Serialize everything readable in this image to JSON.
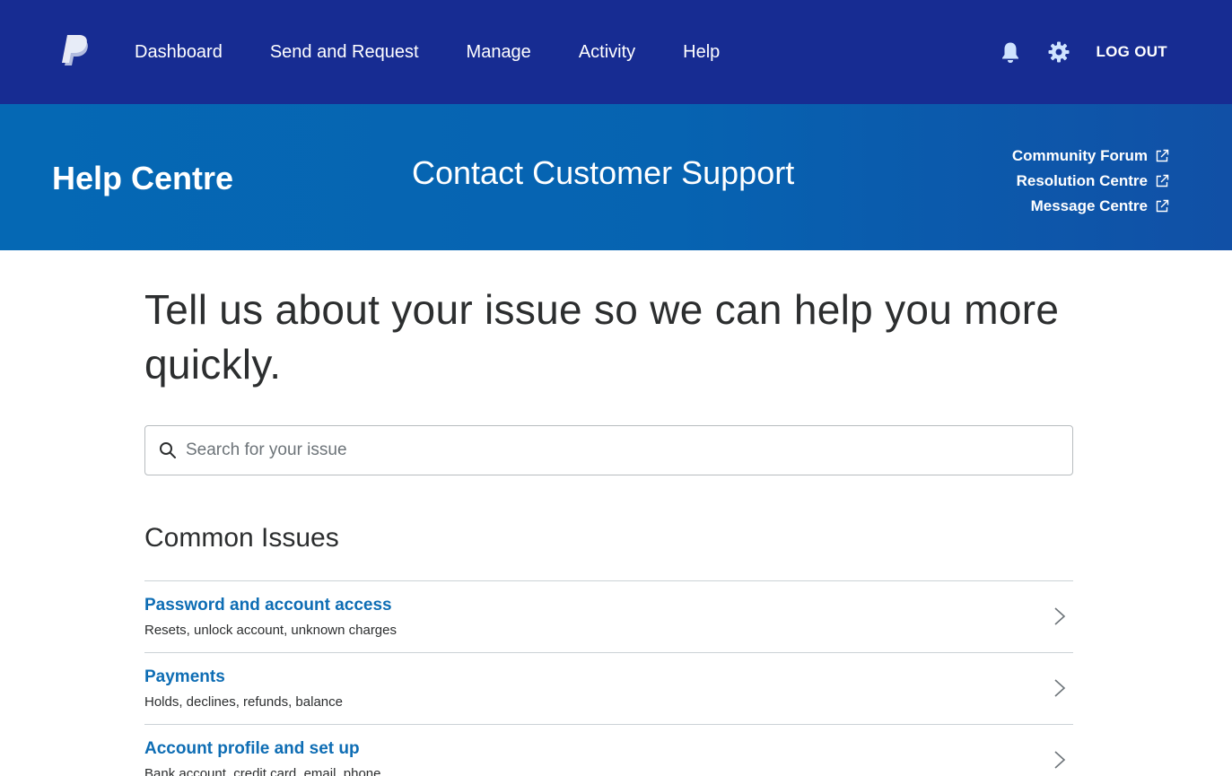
{
  "nav": {
    "logo_icon": "paypal-logo",
    "links": [
      "Dashboard",
      "Send and Request",
      "Manage",
      "Activity",
      "Help"
    ],
    "notifications_icon": "bell-icon",
    "settings_icon": "gear-icon",
    "logout_label": "LOG OUT",
    "background": "#172c92"
  },
  "banner": {
    "title": "Help Centre",
    "heading": "Contact Customer Support",
    "links": [
      "Community Forum",
      "Resolution Centre",
      "Message Centre"
    ],
    "link_icon": "external-link-icon"
  },
  "main": {
    "headline": "Tell us about your issue so we can help you more quickly.",
    "search": {
      "placeholder": "Search for your issue",
      "value": ""
    },
    "section_title": "Common Issues",
    "issues": [
      {
        "title": "Password and account access",
        "subtitle": "Resets, unlock account, unknown charges"
      },
      {
        "title": "Payments",
        "subtitle": "Holds, declines, refunds, balance"
      },
      {
        "title": "Account profile and set up",
        "subtitle": "Bank account, credit card, email, phone"
      }
    ]
  },
  "colors": {
    "link": "#0e6db4",
    "banner_start": "#0568b4",
    "banner_end": "#1150a6"
  }
}
